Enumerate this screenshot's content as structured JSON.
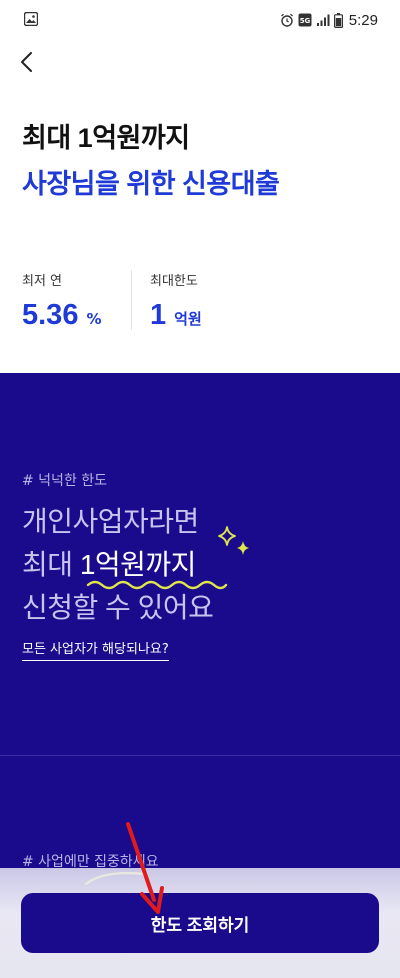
{
  "status_bar": {
    "time": "5:29",
    "left_icon": "gallery-icon",
    "icons": [
      "alarm-icon",
      "5g-icon",
      "signal-icon",
      "battery-icon"
    ]
  },
  "nav": {
    "back_icon": "chevron-left-icon"
  },
  "hero": {
    "title": "최대 1억원까지",
    "subtitle": "사장님을 위한 신용대출"
  },
  "stats": [
    {
      "label": "최저 연",
      "value": "5.36",
      "unit": "%"
    },
    {
      "label": "최대한도",
      "value": "1",
      "unit": "억원"
    }
  ],
  "promo": {
    "tag": "# 넉넉한 한도",
    "line1": "개인사업자라면",
    "line2_prefix": "최대 ",
    "line2_highlight": "1억원까지",
    "line3": "신청할 수 있어요",
    "link_text": "모든 사업자가 해당되나요?",
    "tag2": "# 사업에만 집중하세요"
  },
  "cta": {
    "label": "한도 조회하기"
  },
  "colors": {
    "brand_blue": "#1f3ad6",
    "promo_bg": "#1a0a8c",
    "accent_yellow": "#dfe84a",
    "annotation_red": "#e01b1b"
  }
}
